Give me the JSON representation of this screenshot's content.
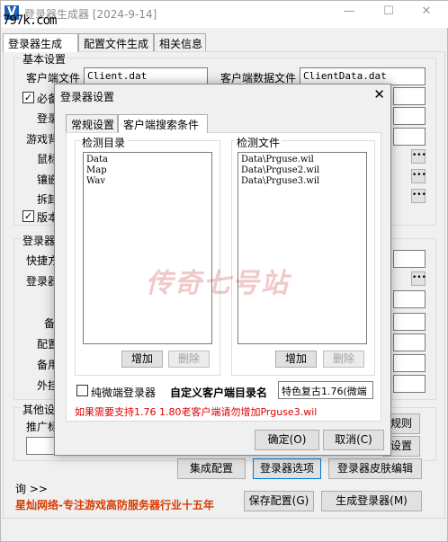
{
  "window": {
    "title": "登录器生成器 [2024-9-14]",
    "watermark_url": "797k.com",
    "minimize": "—",
    "maximize": "☐",
    "close": "✕"
  },
  "main_tabs": [
    "登录器生成",
    "配置文件生成",
    "相关信息"
  ],
  "basic": {
    "group": "基本设置",
    "client_file_label": "客户端文件",
    "client_file_value": "Client.dat",
    "client_data_label": "客户端数据文件",
    "client_data_value": "ClientData.dat",
    "check_required": "必备",
    "login_label": "登录",
    "game_label": "游戏背",
    "mouse_label": "鼠标",
    "embed_label": "镶嵌",
    "split_label": "拆卸",
    "version_check": "版本"
  },
  "launcher": {
    "group": "登录器",
    "shortcut_label": "快捷方",
    "login_label": "登录器",
    "backup_label": "备",
    "config_label": "配置",
    "backup2_label": "备用",
    "external_label": "外挂"
  },
  "other": {
    "group": "其他设",
    "recommend_label": "推广标",
    "rule_btn": "规则",
    "settings_btn": "设置"
  },
  "bottom": {
    "integrated_config": "集成配置",
    "launcher_options": "登录器选项",
    "skin_editor": "登录器皮肤编辑",
    "prefix": "询 >>",
    "brand": "星灿网络-专注游戏高防服务器行业十五年",
    "save_config": "保存配置(G)",
    "generate": "生成登录器(M)"
  },
  "dialog": {
    "title": "登录器设置",
    "close": "✕",
    "tabs": [
      "常规设置",
      "客户端搜索条件"
    ],
    "detect_dirs_label": "检测目录",
    "detect_dirs": [
      "Data",
      "Map",
      "Wav"
    ],
    "detect_files_label": "检测文件",
    "detect_files": [
      "Data\\Prguse.wil",
      "Data\\Prguse2.wil",
      "Data\\Prguse3.wil"
    ],
    "add": "增加",
    "delete": "删除",
    "micro_client": "纯微端登录器",
    "custom_dir_label": "自定义客户端目录名",
    "custom_dir_value": "特色复古1.76(微端",
    "hint": "如果需要支持1.76 1.80老客户端请勿增加Prguse3.wil",
    "ok": "确定(O)",
    "cancel": "取消(C)"
  },
  "overlay_watermark": "传奇七号站"
}
